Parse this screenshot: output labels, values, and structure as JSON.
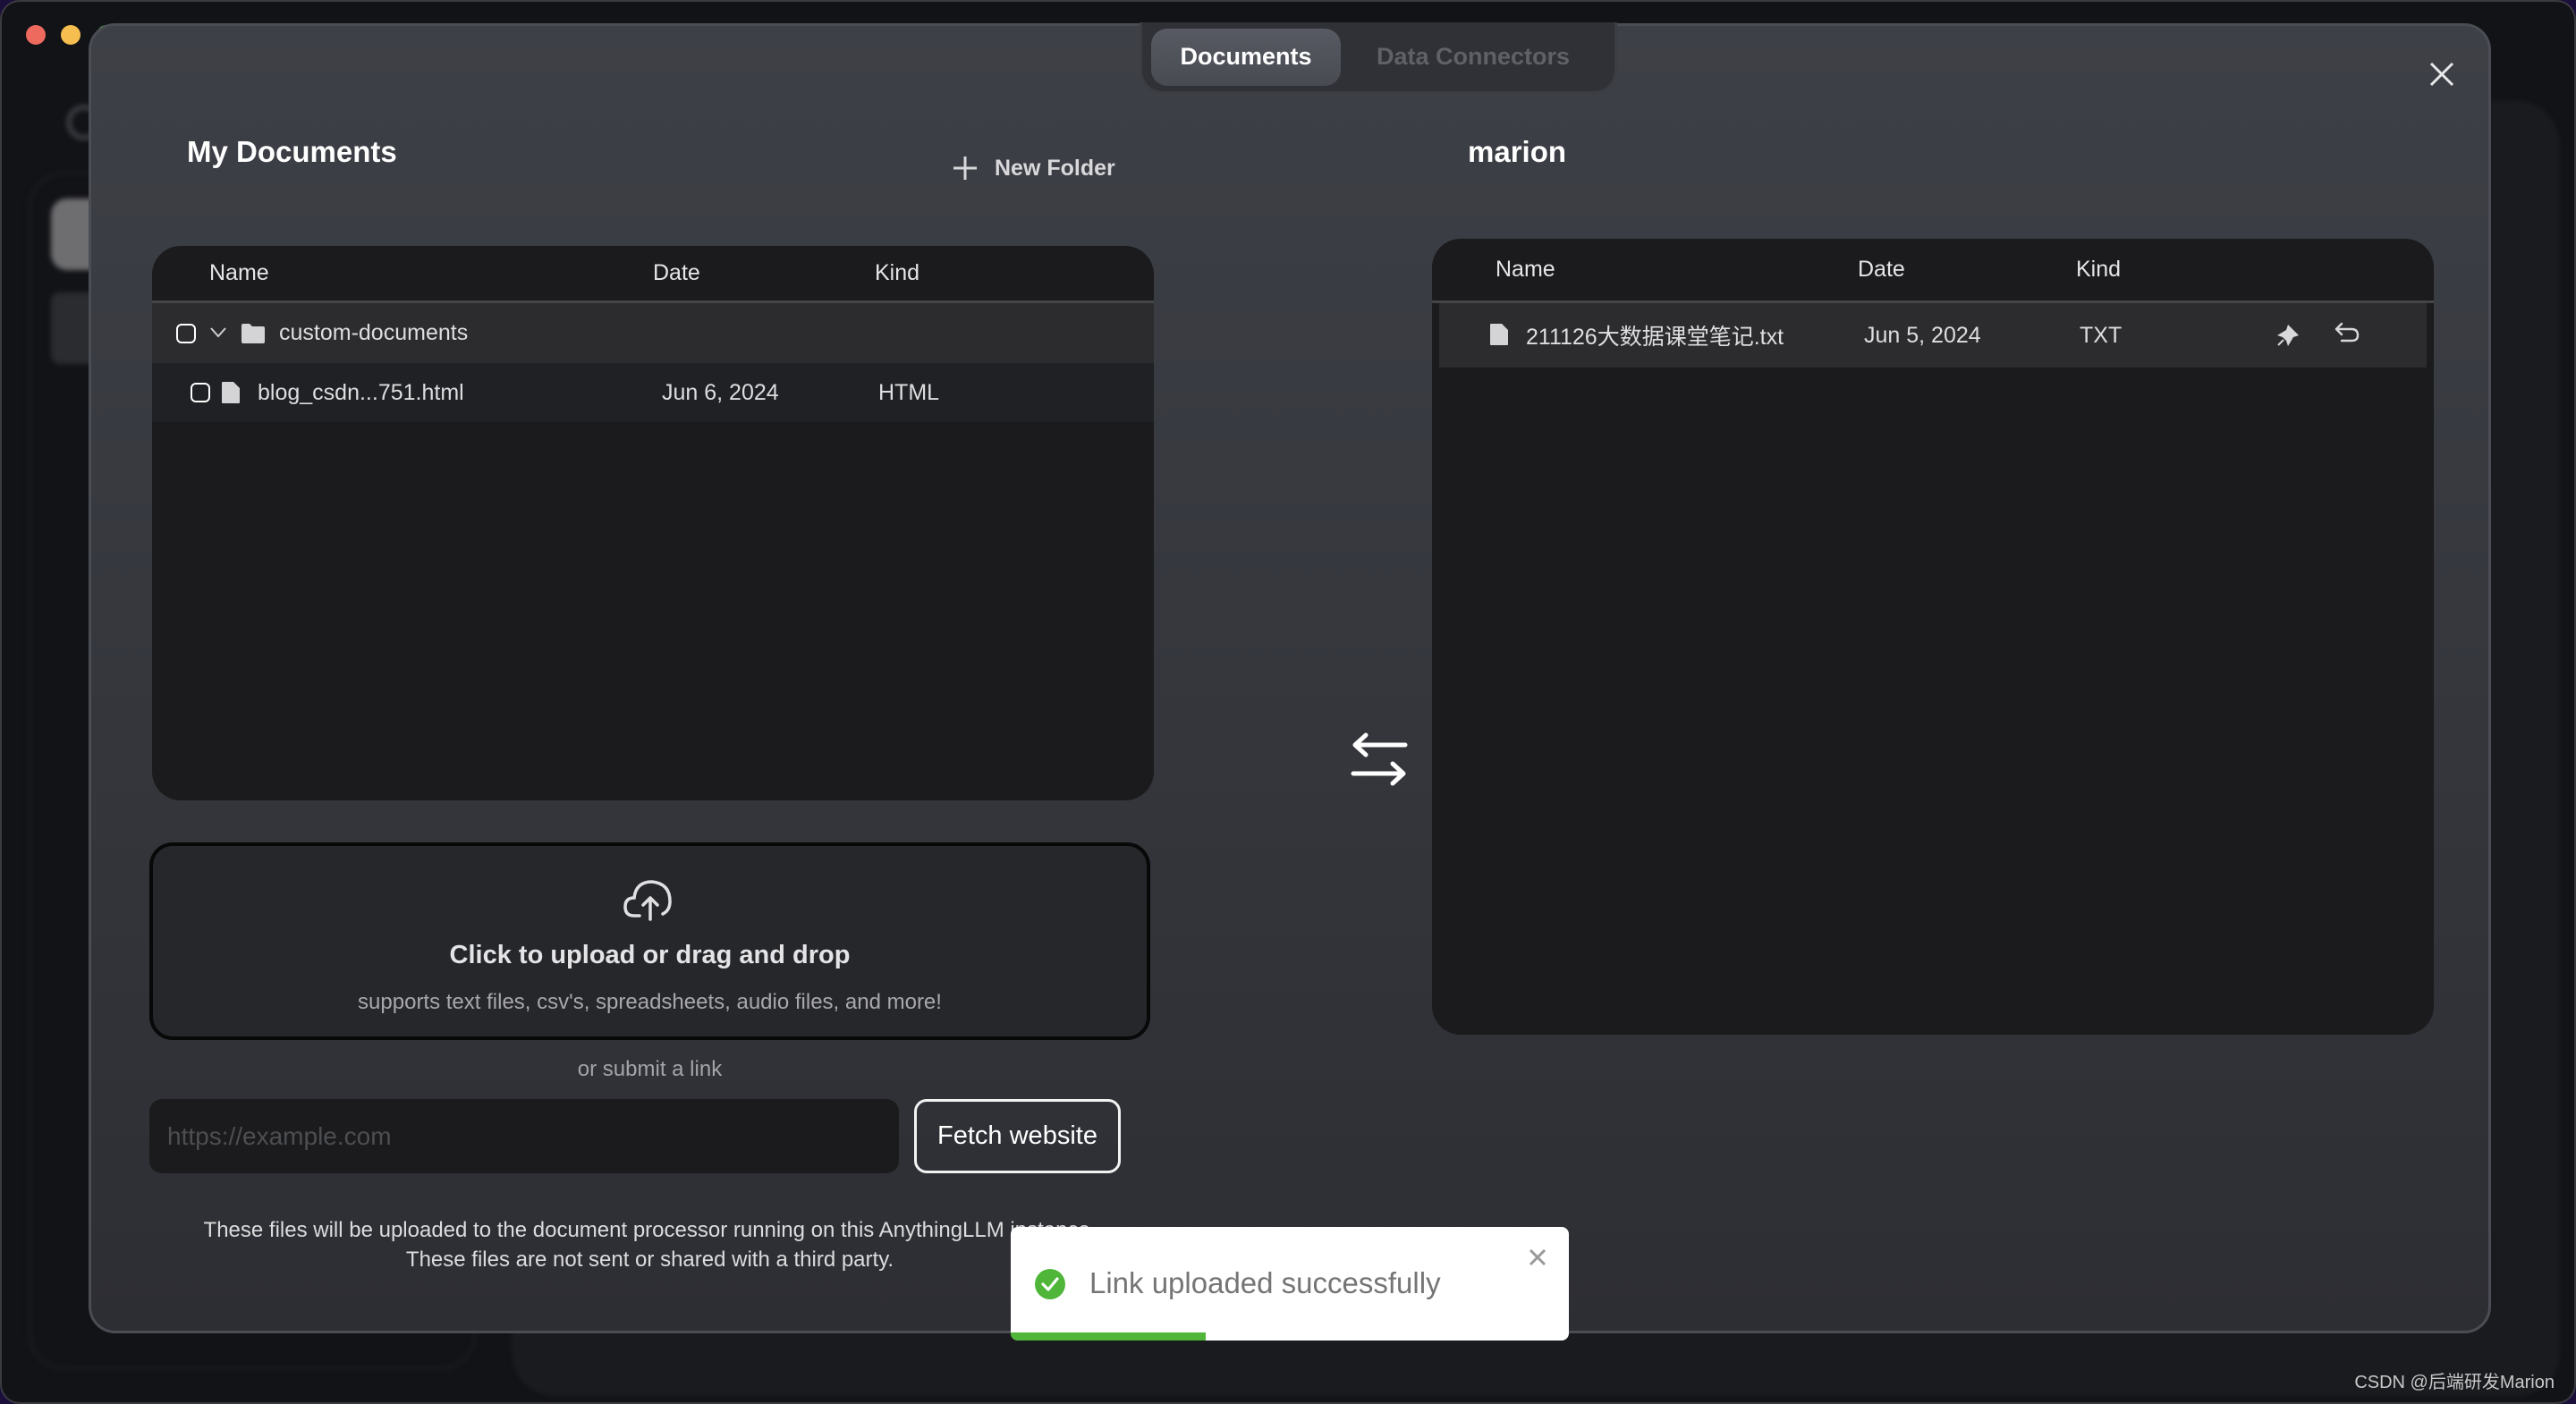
{
  "tabs": [
    {
      "label": "Documents",
      "active": true
    },
    {
      "label": "Data Connectors",
      "active": false
    }
  ],
  "my_documents": {
    "title": "My Documents",
    "new_folder_label": "New Folder",
    "columns": {
      "name": "Name",
      "date": "Date",
      "kind": "Kind"
    },
    "folders": [
      {
        "name": "custom-documents",
        "expanded": true,
        "checked": false,
        "files": [
          {
            "name": "blog_csdn...751.html",
            "date": "Jun 6, 2024",
            "kind": "HTML",
            "checked": false
          }
        ]
      }
    ]
  },
  "workspace": {
    "title": "marion",
    "columns": {
      "name": "Name",
      "date": "Date",
      "kind": "Kind"
    },
    "files": [
      {
        "name": "211126大数据课堂笔记.txt",
        "date": "Jun 5, 2024",
        "kind": "TXT",
        "pinned": true
      }
    ]
  },
  "upload": {
    "title": "Click to upload or drag and drop",
    "subtitle": "supports text files, csv's, spreadsheets, audio files, and more!",
    "or_link_label": "or submit a link",
    "url_placeholder": "https://example.com",
    "url_value": "",
    "fetch_label": "Fetch website",
    "note_line1": "These files will be uploaded to the document processor running on this AnythingLLM instance.",
    "note_line2": "These files are not sent or shared with a third party."
  },
  "toast": {
    "message": "Link uploaded successfully",
    "status": "success",
    "progress_percent": 35,
    "accent_color": "#4fb63a"
  },
  "watermark": "CSDN @后端研发Marion"
}
